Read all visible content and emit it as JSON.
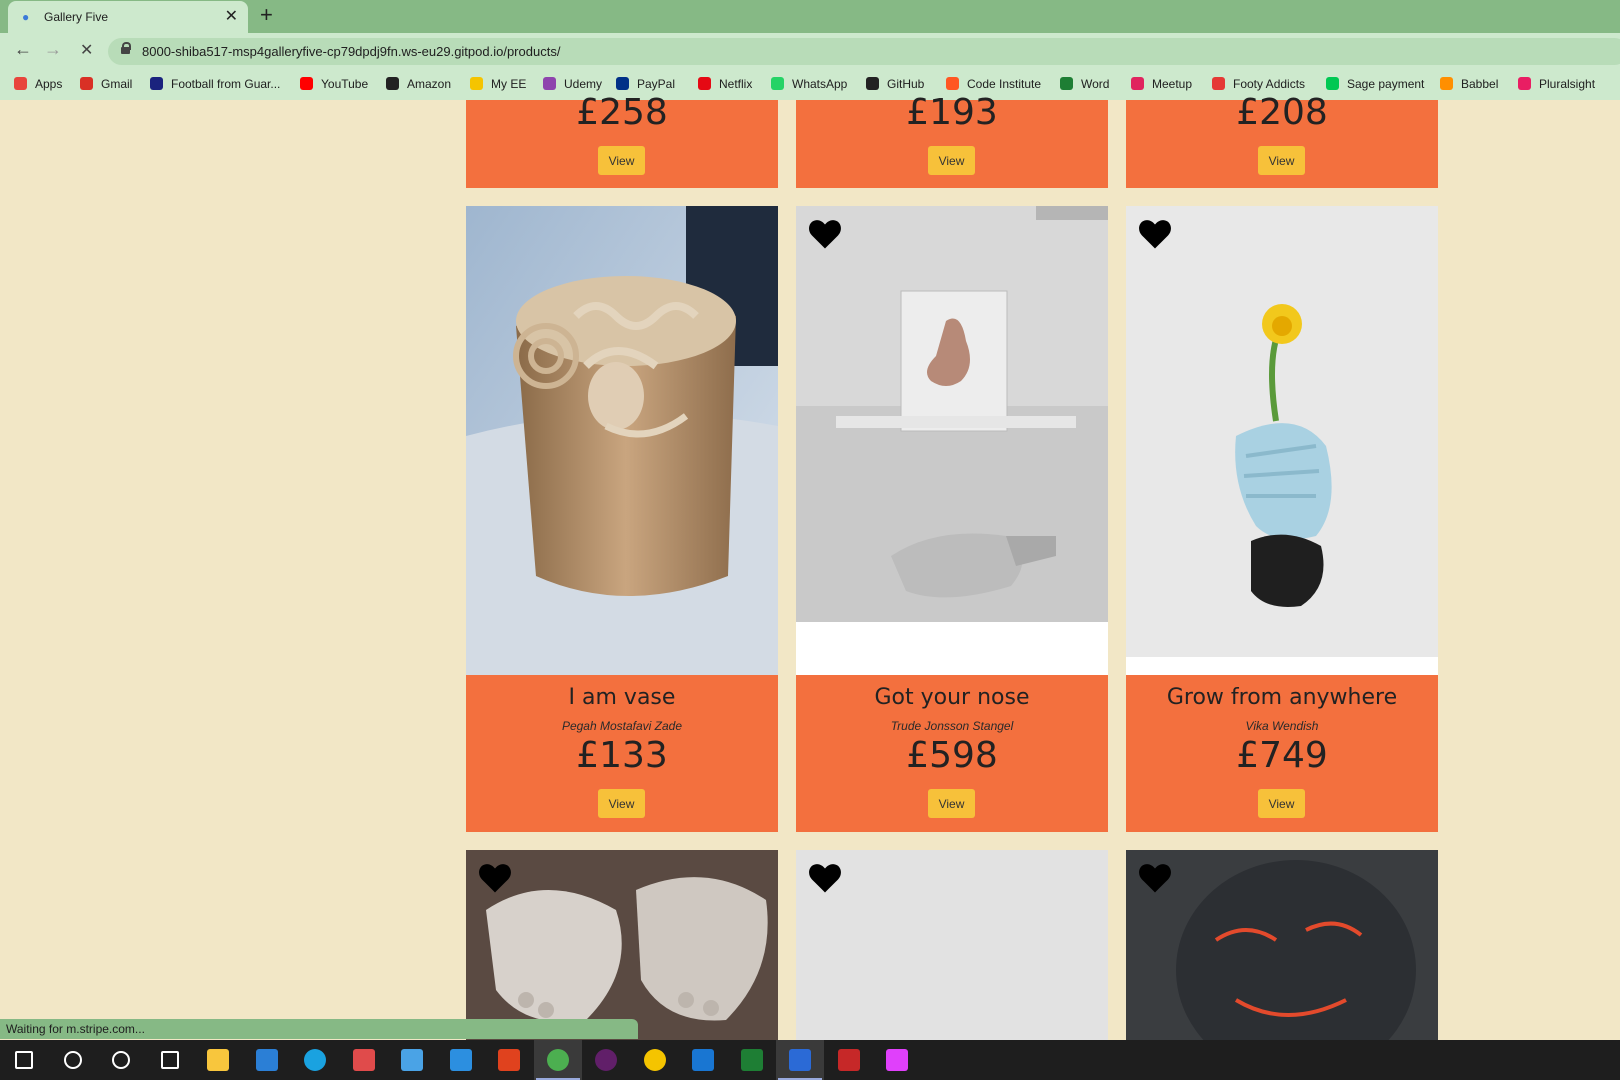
{
  "browser": {
    "tab_title": "Gallery Five",
    "tab_close": "✕",
    "new_tab": "+",
    "back": "←",
    "forward": "→",
    "reload": "✕",
    "url": "8000-shiba517-msp4galleryfive-cp79dpdj9fn.ws-eu29.gitpod.io/products/",
    "bookmarks": [
      "Apps",
      "Gmail",
      "Football from Guar...",
      "YouTube",
      "Amazon",
      "My EE",
      "Udemy",
      "PayPal",
      "Netflix",
      "WhatsApp",
      "GitHub",
      "Code Institute",
      "Word",
      "Meetup",
      "Footy Addicts",
      "Sage payment",
      "Babbel",
      "Pluralsight"
    ],
    "bookmark_colors": [
      "#e8453c",
      "#d93025",
      "#1a237e",
      "#ff0000",
      "#222222",
      "#f5c400",
      "#8e44ad",
      "#003087",
      "#e50914",
      "#25d366",
      "#222222",
      "#ff5722",
      "#1e7e34",
      "#e0245e",
      "#e53935",
      "#00c853",
      "#ff8f00",
      "#e91e63"
    ]
  },
  "products": {
    "view_label": "View",
    "top_row": [
      {
        "price": "£258"
      },
      {
        "price": "£193"
      },
      {
        "price": "£208"
      }
    ],
    "middle_row": [
      {
        "title": "I am vase",
        "artist": "Pegah Mostafavi Zade",
        "price": "£133"
      },
      {
        "title": "Got your nose",
        "artist": "Trude Jonsson Stangel",
        "price": "£598"
      },
      {
        "title": "Grow from anywhere",
        "artist": "Vika Wendish",
        "price": "£749"
      }
    ]
  },
  "status": "Waiting for m.stripe.com...",
  "taskbar": {
    "icons": [
      "windows-start",
      "search",
      "cortana",
      "task-view",
      "file-explorer",
      "store",
      "edge",
      "gift",
      "mail",
      "vscode",
      "office",
      "chrome",
      "slack",
      "emoji",
      "photos",
      "excel",
      "security",
      "mcafee",
      "paint"
    ],
    "colors": [
      "#ffffff",
      "#ffffff",
      "#ffffff",
      "#ffffff",
      "#f8c63d",
      "#2b7fd6",
      "#1aa2e0",
      "#e04b4b",
      "#4aa3e6",
      "#2c8fe0",
      "#e0421e",
      "#4caf50",
      "#611f69",
      "#f5c400",
      "#1976d2",
      "#1e7e34",
      "#2b6ad6",
      "#c62828",
      "#e040fb"
    ]
  },
  "colors": {
    "page_bg": "#f2e7c6",
    "card_footer": "#f3703e",
    "view_button": "#f7c13a",
    "chrome_green": "#86b985"
  }
}
